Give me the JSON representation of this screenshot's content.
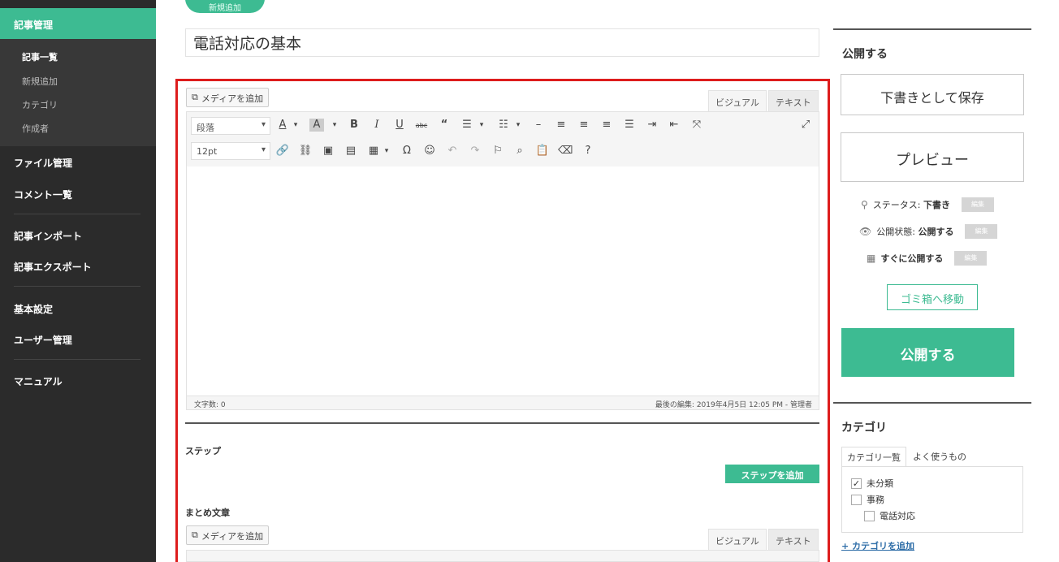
{
  "sidebar": {
    "active": "記事管理",
    "subitems": [
      "記事一覧",
      "新規追加",
      "カテゴリ",
      "作成者"
    ],
    "items": [
      "ファイル管理",
      "コメント一覧",
      "記事インポート",
      "記事エクスポート",
      "基本設定",
      "ユーザー管理",
      "マニュアル"
    ]
  },
  "top_button": "新規追加",
  "post_title": "電話対応の基本",
  "editor": {
    "media_button": "メディアを追加",
    "tab_visual": "ビジュアル",
    "tab_text": "テキスト",
    "format_select": "段落",
    "fontsize_select": "12pt",
    "word_count": "文字数: 0",
    "last_edit": "最後の編集: 2019年4月5日 12:05 PM - 管理者"
  },
  "steps": {
    "label": "ステップ",
    "add_button": "ステップを追加"
  },
  "summary": {
    "label": "まとめ文章",
    "media_button": "メディアを追加",
    "tab_visual": "ビジュアル",
    "tab_text": "テキスト"
  },
  "publish": {
    "title": "公開する",
    "save_draft": "下書きとして保存",
    "preview": "プレビュー",
    "status_label": "ステータス:",
    "status_value": "下書き",
    "visibility_label": "公開状態:",
    "visibility_value": "公開する",
    "schedule_label": "すぐに公開する",
    "edit_label": "編集",
    "trash": "ゴミ箱へ移動",
    "publish_button": "公開する"
  },
  "category": {
    "title": "カテゴリ",
    "tab_all": "カテゴリ一覧",
    "tab_popular": "よく使うもの",
    "items": [
      {
        "label": "未分類",
        "checked": true
      },
      {
        "label": "事務",
        "checked": false
      },
      {
        "label": "電話対応",
        "checked": false
      }
    ],
    "add_link": "+ カテゴリを追加"
  },
  "colors": {
    "accent": "#3dbb92",
    "sidebar_bg": "#2b2b2b",
    "highlight_frame": "#dd1d1d"
  }
}
